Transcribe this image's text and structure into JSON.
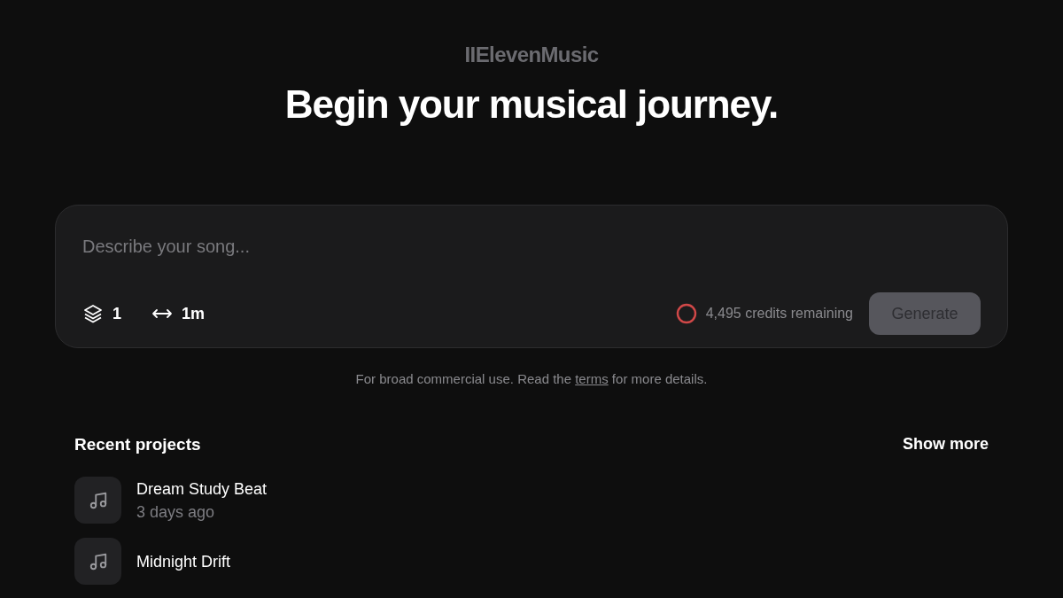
{
  "logo": "IIElevenMusic",
  "heading": "Begin your musical journey.",
  "prompt": {
    "placeholder": "Describe your song...",
    "variants": "1",
    "duration": "1m",
    "credits": "4,495 credits remaining",
    "generate": {
      "label": "Generate",
      "disabled": true
    }
  },
  "notice": {
    "before": "For broad commercial use. Read the ",
    "link": "terms",
    "after": " for more details."
  },
  "recent": {
    "title": "Recent projects",
    "show_more": "Show more",
    "projects": [
      {
        "title": "Dream Study Beat",
        "time": "3 days ago"
      },
      {
        "title": "Midnight Drift"
      }
    ]
  }
}
